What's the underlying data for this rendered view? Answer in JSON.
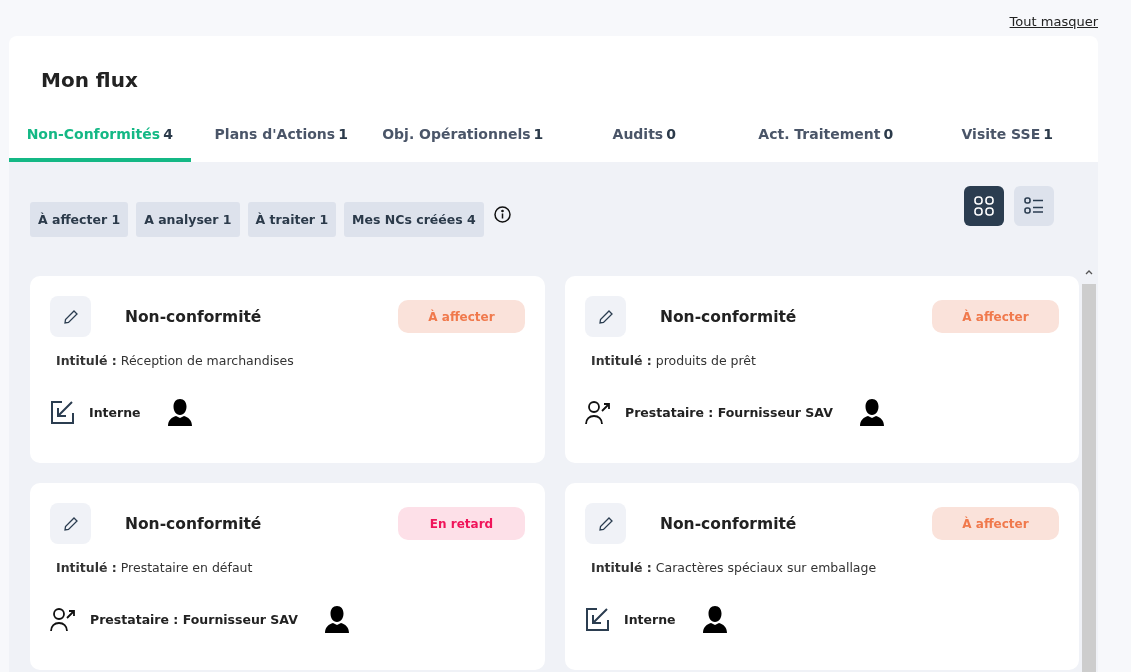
{
  "header": {
    "hide_all_link": "Tout masquer"
  },
  "panel": {
    "title": "Mon flux"
  },
  "tabs": [
    {
      "label": "Non-Conformités",
      "count": "4",
      "selected": true
    },
    {
      "label": "Plans d'Actions",
      "count": "1",
      "selected": false
    },
    {
      "label": "Obj. Opérationnels",
      "count": "1",
      "selected": false
    },
    {
      "label": "Audits",
      "count": "0",
      "selected": false
    },
    {
      "label": "Act. Traitement",
      "count": "0",
      "selected": false
    },
    {
      "label": "Visite SSE",
      "count": "1",
      "selected": false
    }
  ],
  "filters": [
    {
      "label": "À affecter",
      "count": "1"
    },
    {
      "label": "A analyser",
      "count": "1"
    },
    {
      "label": "À traiter",
      "count": "1"
    },
    {
      "label": "Mes NCs créées",
      "count": "4"
    }
  ],
  "view_toggle": [
    {
      "kind": "grid",
      "selected": true
    },
    {
      "kind": "list",
      "selected": false
    }
  ],
  "cards": [
    {
      "title": "Non-conformité",
      "status": {
        "label": "À affecter",
        "kind": "to_assign"
      },
      "subject": "**Intitulé :** Réception de marchandises",
      "origin": {
        "kind": "internal",
        "label": "Interne"
      }
    },
    {
      "title": "Non-conformité",
      "status": {
        "label": "À affecter",
        "kind": "to_assign"
      },
      "subject": "**Intitulé :** produits de prêt",
      "origin": {
        "kind": "provider",
        "label": "Prestataire : Fournisseur SAV"
      }
    },
    {
      "title": "Non-conformité",
      "status": {
        "label": "En retard",
        "kind": "late"
      },
      "subject": "**Intitulé :** Prestataire en défaut",
      "origin": {
        "kind": "provider",
        "label": "Prestataire : Fournisseur SAV"
      }
    },
    {
      "title": "Non-conformité",
      "status": {
        "label": "À affecter",
        "kind": "to_assign"
      },
      "subject": "**Intitulé :** Caractères spéciaux sur emballage",
      "origin": {
        "kind": "internal",
        "label": "Interne"
      }
    }
  ]
}
